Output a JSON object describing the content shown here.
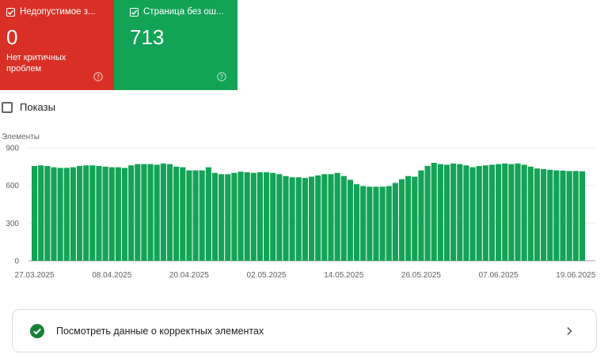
{
  "cards": {
    "invalid": {
      "title": "Недопустимое з...",
      "value": "0",
      "subtitle": "Нет критичных проблем",
      "color": "#d93025"
    },
    "valid": {
      "title": "Страница без ош...",
      "value": "713",
      "color": "#13a356"
    }
  },
  "impressions": {
    "label": "Показы",
    "checked": false
  },
  "chart_data": {
    "type": "bar",
    "ylabel": "Элементы",
    "ylim": [
      0,
      900
    ],
    "yticks": [
      0,
      300,
      600,
      900
    ],
    "xtick_labels": [
      "27.03.2025",
      "08.04.2025",
      "20.04.2025",
      "02.05.2025",
      "14.05.2025",
      "26.05.2025",
      "07.06.2025",
      "19.06.2025"
    ],
    "xtick_indices": [
      0,
      12,
      24,
      36,
      48,
      60,
      72,
      84
    ],
    "color": "#13a356",
    "series": [
      {
        "values": [
          755,
          760,
          755,
          745,
          740,
          740,
          745,
          755,
          760,
          760,
          755,
          750,
          745,
          745,
          740,
          760,
          770,
          770,
          770,
          765,
          775,
          770,
          750,
          745,
          720,
          720,
          720,
          745,
          700,
          690,
          690,
          700,
          710,
          705,
          700,
          705,
          705,
          700,
          690,
          675,
          665,
          665,
          660,
          670,
          680,
          690,
          690,
          700,
          675,
          645,
          610,
          595,
          590,
          590,
          590,
          595,
          620,
          650,
          675,
          670,
          720,
          755,
          780,
          770,
          765,
          775,
          770,
          760,
          745,
          755,
          760,
          765,
          770,
          775,
          770,
          775,
          765,
          750,
          735,
          730,
          725,
          720,
          718,
          715,
          715,
          713
        ]
      }
    ]
  },
  "footer": {
    "label": "Посмотреть данные о корректных элементах"
  }
}
